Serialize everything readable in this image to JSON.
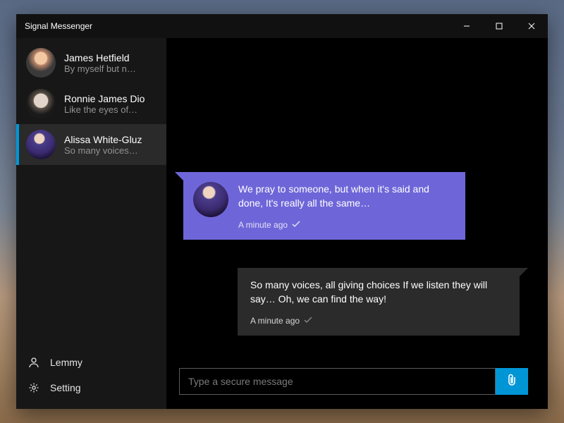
{
  "window": {
    "title": "Signal Messenger"
  },
  "titlebar": {
    "minimize": "−",
    "maximize": "☐",
    "close": "✕"
  },
  "sidebar": {
    "contacts": [
      {
        "name": "James Hetfield",
        "preview": "By myself but n…",
        "selected": false
      },
      {
        "name": "Ronnie James Dio",
        "preview": "Like the eyes of…",
        "selected": false
      },
      {
        "name": "Alissa White-Gluz",
        "preview": "So many voices…",
        "selected": true
      }
    ],
    "footer": {
      "user": "Lemmy",
      "settings": "Setting"
    }
  },
  "chat": {
    "messages": [
      {
        "direction": "incoming",
        "text": "We pray to someone, but when it's said and done, It's really all the same…",
        "timestamp": "A minute ago"
      },
      {
        "direction": "outgoing",
        "text": "So many voices, all giving choices If we listen they will say… Oh, we can find the way!",
        "timestamp": "A minute ago"
      }
    ],
    "composer": {
      "placeholder": "Type a secure message"
    }
  },
  "colors": {
    "accent": "#0096d6",
    "bubbleIncoming": "#6e66d8",
    "bubbleOutgoing": "#2b2b2b"
  }
}
